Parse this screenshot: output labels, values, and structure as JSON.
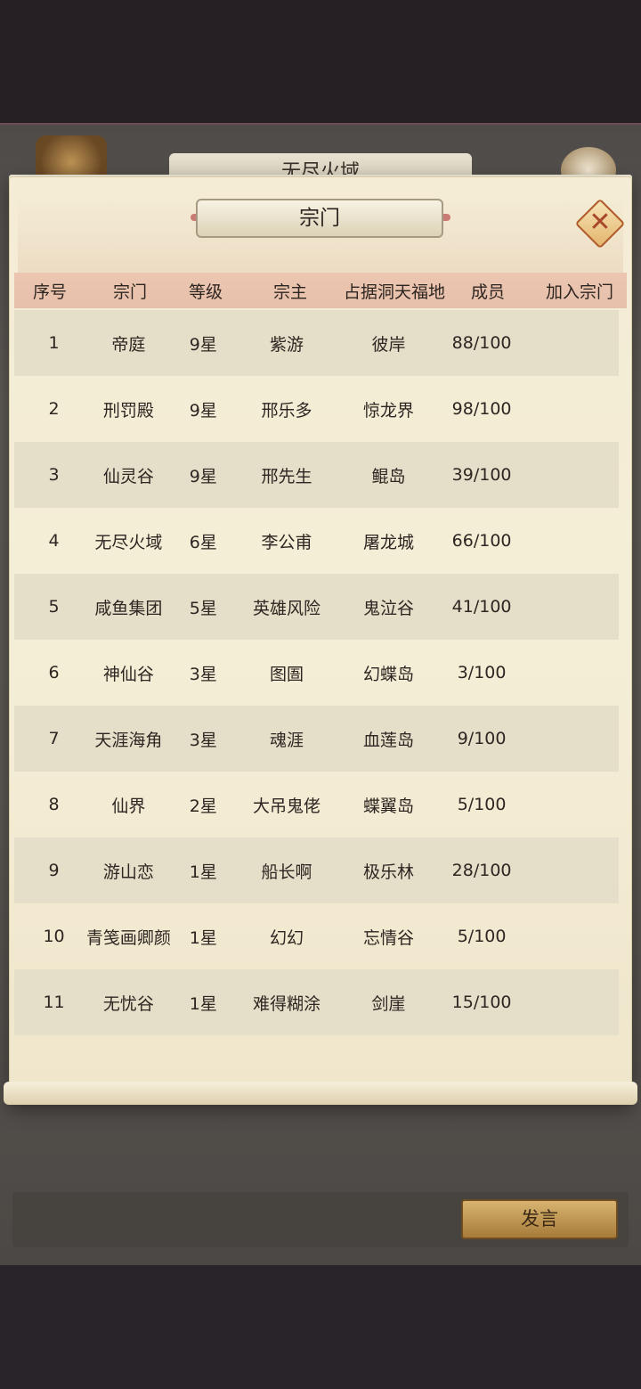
{
  "background": {
    "header_title": "无尽火域"
  },
  "dialog": {
    "title": "宗门",
    "close_label": "✕"
  },
  "table": {
    "headers": [
      "序号",
      "宗门",
      "等级",
      "宗主",
      "占据洞天福地",
      "成员",
      "加入宗门"
    ],
    "rows": [
      {
        "no": "1",
        "sect": "帝庭",
        "level": "9星",
        "leader": "紫游",
        "territory": "彼岸",
        "members": "88/100"
      },
      {
        "no": "2",
        "sect": "刑罚殿",
        "level": "9星",
        "leader": "邢乐多",
        "territory": "惊龙界",
        "members": "98/100"
      },
      {
        "no": "3",
        "sect": "仙灵谷",
        "level": "9星",
        "leader": "邢先生",
        "territory": "鲲岛",
        "members": "39/100"
      },
      {
        "no": "4",
        "sect": "无尽火域",
        "level": "6星",
        "leader": "李公甫",
        "territory": "屠龙城",
        "members": "66/100"
      },
      {
        "no": "5",
        "sect": "咸鱼集团",
        "level": "5星",
        "leader": "英雄风险",
        "territory": "鬼泣谷",
        "members": "41/100"
      },
      {
        "no": "6",
        "sect": "神仙谷",
        "level": "3星",
        "leader": "图圄",
        "territory": "幻蝶岛",
        "members": "3/100"
      },
      {
        "no": "7",
        "sect": "天涯海角",
        "level": "3星",
        "leader": "魂涯",
        "territory": "血莲岛",
        "members": "9/100"
      },
      {
        "no": "8",
        "sect": "仙界",
        "level": "2星",
        "leader": "大吊鬼佬",
        "territory": "蝶翼岛",
        "members": "5/100"
      },
      {
        "no": "9",
        "sect": "游山恋",
        "level": "1星",
        "leader": "船长啊",
        "territory": "极乐林",
        "members": "28/100"
      },
      {
        "no": "10",
        "sect": "青笺画卿颜",
        "level": "1星",
        "leader": "幻幻",
        "territory": "忘情谷",
        "members": "5/100"
      },
      {
        "no": "11",
        "sect": "无忧谷",
        "level": "1星",
        "leader": "难得糊涂",
        "territory": "剑崖",
        "members": "15/100"
      }
    ]
  },
  "chat": {
    "send_label": "发言"
  }
}
